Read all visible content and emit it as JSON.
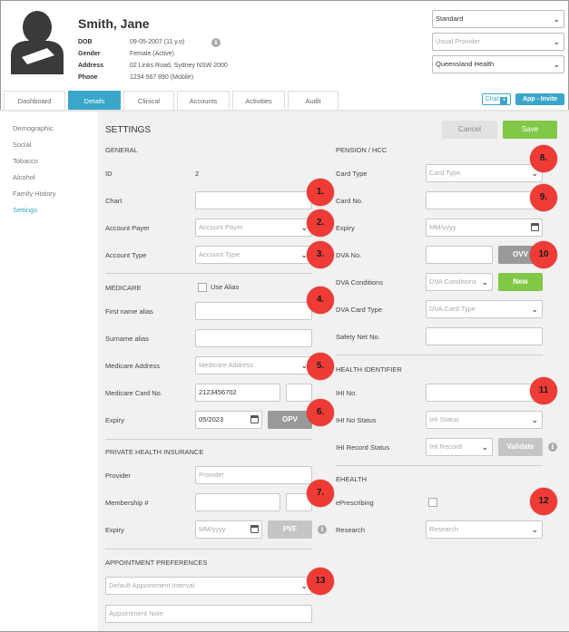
{
  "patient": {
    "name": "Smith, Jane",
    "labels": {
      "dob": "DOB",
      "gender": "Gender",
      "address": "Address",
      "phone": "Phone"
    },
    "dob": "09-05-2007 (11 y.o)",
    "gender": "Female (Active)",
    "address": "02 Links Road, Sydney NSW 2000",
    "phone": "1234 567 890 (Mobile)"
  },
  "top_selects": {
    "billing": "Standard",
    "usual_provider_placeholder": "Usual Provider",
    "health_service": "Queensland Health"
  },
  "tabs": [
    "Dashboard",
    "Details",
    "Clinical",
    "Accounts",
    "Activities",
    "Audit"
  ],
  "active_tab": "Details",
  "header_buttons": {
    "chat": "Chat",
    "app": "App - Invite"
  },
  "sidebar": [
    "Demographic",
    "Social",
    "Tobacco",
    "Alcohol",
    "Family History",
    "Settings"
  ],
  "active_sidebar": "Settings",
  "settings": {
    "title": "SETTINGS",
    "cancel": "Cancel",
    "save": "Save",
    "general": {
      "heading": "GENERAL",
      "id_label": "ID",
      "id_value": "2",
      "chart_label": "Chart",
      "chart_value": "",
      "account_payer_label": "Account Payer",
      "account_payer_placeholder": "Account Payer",
      "account_type_label": "Account Type",
      "account_type_placeholder": "Account Type"
    },
    "medicare": {
      "heading": "MEDICARE",
      "use_alias": "Use Alias",
      "first_alias_label": "First name alias",
      "surname_alias_label": "Surname alias",
      "address_label": "Medicare Address",
      "address_placeholder": "Medicare Address",
      "card_no_label": "Medicare Card No.",
      "card_no_value": "2123456702",
      "expiry_label": "Expiry",
      "expiry_value": "05/2023",
      "opv": "OPV"
    },
    "phi": {
      "heading": "PRIVATE HEALTH INSURANCE",
      "provider_label": "Provider",
      "provider_placeholder": "Provider",
      "membership_label": "Membership #",
      "expiry_label": "Expiry",
      "expiry_placeholder": "MM/yyyy",
      "pvf": "PVF"
    },
    "appointment": {
      "heading": "APPOINTMENT PREFERENCES",
      "interval_placeholder": "Default Appointment Interval",
      "note_placeholder": "Appointment Note"
    },
    "pension": {
      "heading": "PENSION / HCC",
      "card_type_label": "Card Type",
      "card_type_placeholder": "Card Type",
      "card_no_label": "Card No.",
      "expiry_label": "Expiry",
      "expiry_placeholder": "MM/yyyy",
      "dva_no_label": "DVA No.",
      "ovv": "OVV",
      "dva_conditions_label": "DVA Conditions",
      "dva_conditions_placeholder": "DVA Conditions",
      "new": "New",
      "dva_card_type_label": "DVA Card Type",
      "dva_card_type_placeholder": "DVA Card Type",
      "safety_net_label": "Safety Net No."
    },
    "health_identifier": {
      "heading": "HEALTH IDENTIFIER",
      "ihi_no_label": "IHI No.",
      "ihi_status_label": "IHI No Status",
      "ihi_status_placeholder": "IHI Status",
      "ihi_record_label": "IHI Record Status",
      "ihi_record_placeholder": "IHI Record",
      "validate": "Validate"
    },
    "ehealth": {
      "heading": "EHEALTH",
      "eprescribing_label": "ePrescribing",
      "research_label": "Research",
      "research_placeholder": "Research"
    }
  },
  "markers": [
    "1.",
    "2.",
    "3.",
    "4.",
    "5.",
    "6.",
    "7.",
    "8.",
    "9.",
    "10",
    "11",
    "12",
    "13"
  ],
  "colors": {
    "accent": "#3aa6c9",
    "save_green": "#80c846",
    "marker_red": "#ef3b36"
  }
}
